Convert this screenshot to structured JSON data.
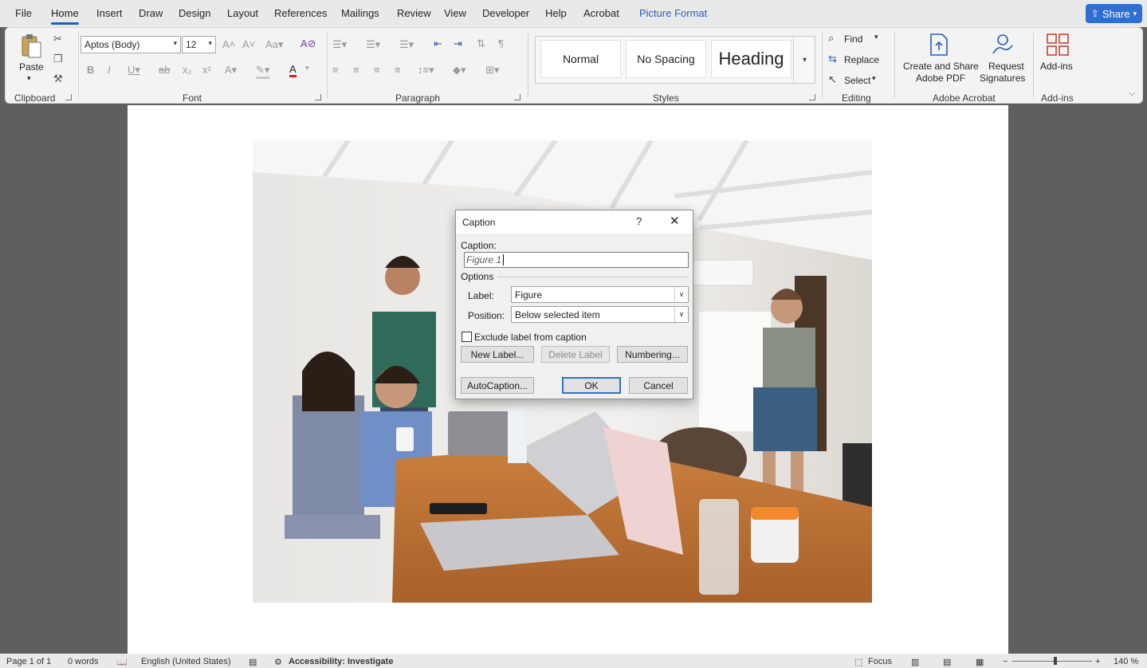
{
  "menu": {
    "items": [
      "File",
      "Home",
      "Insert",
      "Draw",
      "Design",
      "Layout",
      "References",
      "Mailings",
      "Review",
      "View",
      "Developer",
      "Help",
      "Acrobat",
      "Picture Format"
    ],
    "active": "Home",
    "share_label": "Share"
  },
  "ribbon": {
    "clipboard": {
      "paste_label": "Paste",
      "group_label": "Clipboard"
    },
    "font": {
      "font_name": "Aptos (Body)",
      "font_size": "12",
      "group_label": "Font"
    },
    "paragraph": {
      "group_label": "Paragraph"
    },
    "styles": {
      "items": [
        "Normal",
        "No Spacing",
        "Heading"
      ],
      "group_label": "Styles"
    },
    "editing": {
      "find_label": "Find",
      "replace_label": "Replace",
      "select_label": "Select",
      "group_label": "Editing"
    },
    "acrobat": {
      "create_label_1": "Create and Share",
      "create_label_2": "Adobe PDF",
      "request_label_1": "Request",
      "request_label_2": "Signatures",
      "group_label": "Adobe Acrobat"
    },
    "addins": {
      "button_label": "Add-ins",
      "group_label": "Add-ins"
    }
  },
  "dialog": {
    "title": "Caption",
    "help": "?",
    "caption_label": "Caption:",
    "caption_value": "Figure 1",
    "options_label": "Options",
    "label_label": "Label:",
    "label_value": "Figure",
    "position_label": "Position:",
    "position_value": "Below selected item",
    "exclude_label": "Exclude label from caption",
    "new_label_btn": "New Label...",
    "delete_label_btn": "Delete Label",
    "numbering_btn": "Numbering...",
    "autocaption_btn": "AutoCaption...",
    "ok_btn": "OK",
    "cancel_btn": "Cancel"
  },
  "status": {
    "page": "Page 1 of 1",
    "words": "0 words",
    "language": "English (United States)",
    "accessibility": "Accessibility: Investigate",
    "focus": "Focus",
    "zoom": "140 %"
  }
}
